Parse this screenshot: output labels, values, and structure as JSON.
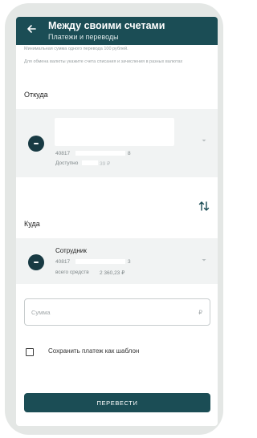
{
  "header": {
    "title": "Между своими счетами",
    "subtitle": "Платежи и переводы"
  },
  "hints": {
    "min_amount": "Минимальная сумма одного перевода 100 рублей.",
    "currency_exchange": "Для обмена валюты укажите счета списания и зачисления в разных валютах"
  },
  "from": {
    "label": "Откуда",
    "account_prefix": "40817",
    "account_suffix": "8",
    "available_label": "Доступно",
    "available_amount": "39 ₽"
  },
  "to": {
    "label": "Куда",
    "payee_name": "Сотрудник",
    "account_prefix": "40817",
    "account_suffix": "3",
    "total_label": "всего средств",
    "total_amount": "2 360,23 ₽"
  },
  "amount": {
    "placeholder": "Сумма",
    "currency_sign": "₽"
  },
  "save_template": {
    "label": "Сохранить платеж как шаблон",
    "checked": false
  },
  "submit": {
    "label": "ПЕРЕВЕСТИ"
  },
  "colors": {
    "primary": "#1b4d55",
    "icon_bg": "#183a43",
    "card_bg": "#f1f3f3",
    "frame": "#e4e7e5"
  },
  "icons": [
    "back-arrow-icon",
    "account-icon",
    "chevron-down-icon",
    "swap-arrows-icon"
  ]
}
